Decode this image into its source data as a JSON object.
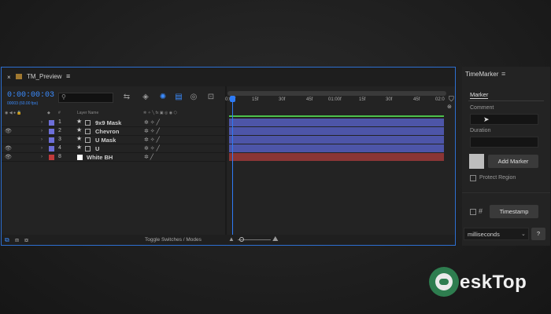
{
  "panel": {
    "tab_title": "TM_Preview",
    "timecode": "0:00:00:03",
    "fps": "00003 (60.00 fps)",
    "col_layer_name": "Layer Name",
    "col_num": "#",
    "toggle_label": "Toggle Switches / Modes"
  },
  "layers": [
    {
      "num": "1",
      "name": "9x9 Mask",
      "color": "#6d6fd8",
      "visible": false
    },
    {
      "num": "2",
      "name": "Chevron",
      "color": "#6d6fd8",
      "visible": true
    },
    {
      "num": "3",
      "name": "U Mask",
      "color": "#6d6fd8",
      "visible": false
    },
    {
      "num": "4",
      "name": "U",
      "color": "#6d6fd8",
      "visible": true
    },
    {
      "num": "8",
      "name": "White BH",
      "color": "#c03a3a",
      "visible": true
    }
  ],
  "ruler_ticks": [
    "0:00f",
    "15f",
    "30f",
    "45f",
    "01:00f",
    "15f",
    "30f",
    "45f",
    "02:0"
  ],
  "right_panel": {
    "title": "TimeMarker",
    "tab": "Marker",
    "comment_label": "Comment",
    "duration_label": "Duration",
    "add_marker": "Add Marker",
    "protect_region": "Protect Region",
    "hash": "#",
    "timestamp": "Timestamp",
    "units": "milliseconds",
    "help": "?"
  },
  "watermark": {
    "text": "eskTop"
  }
}
